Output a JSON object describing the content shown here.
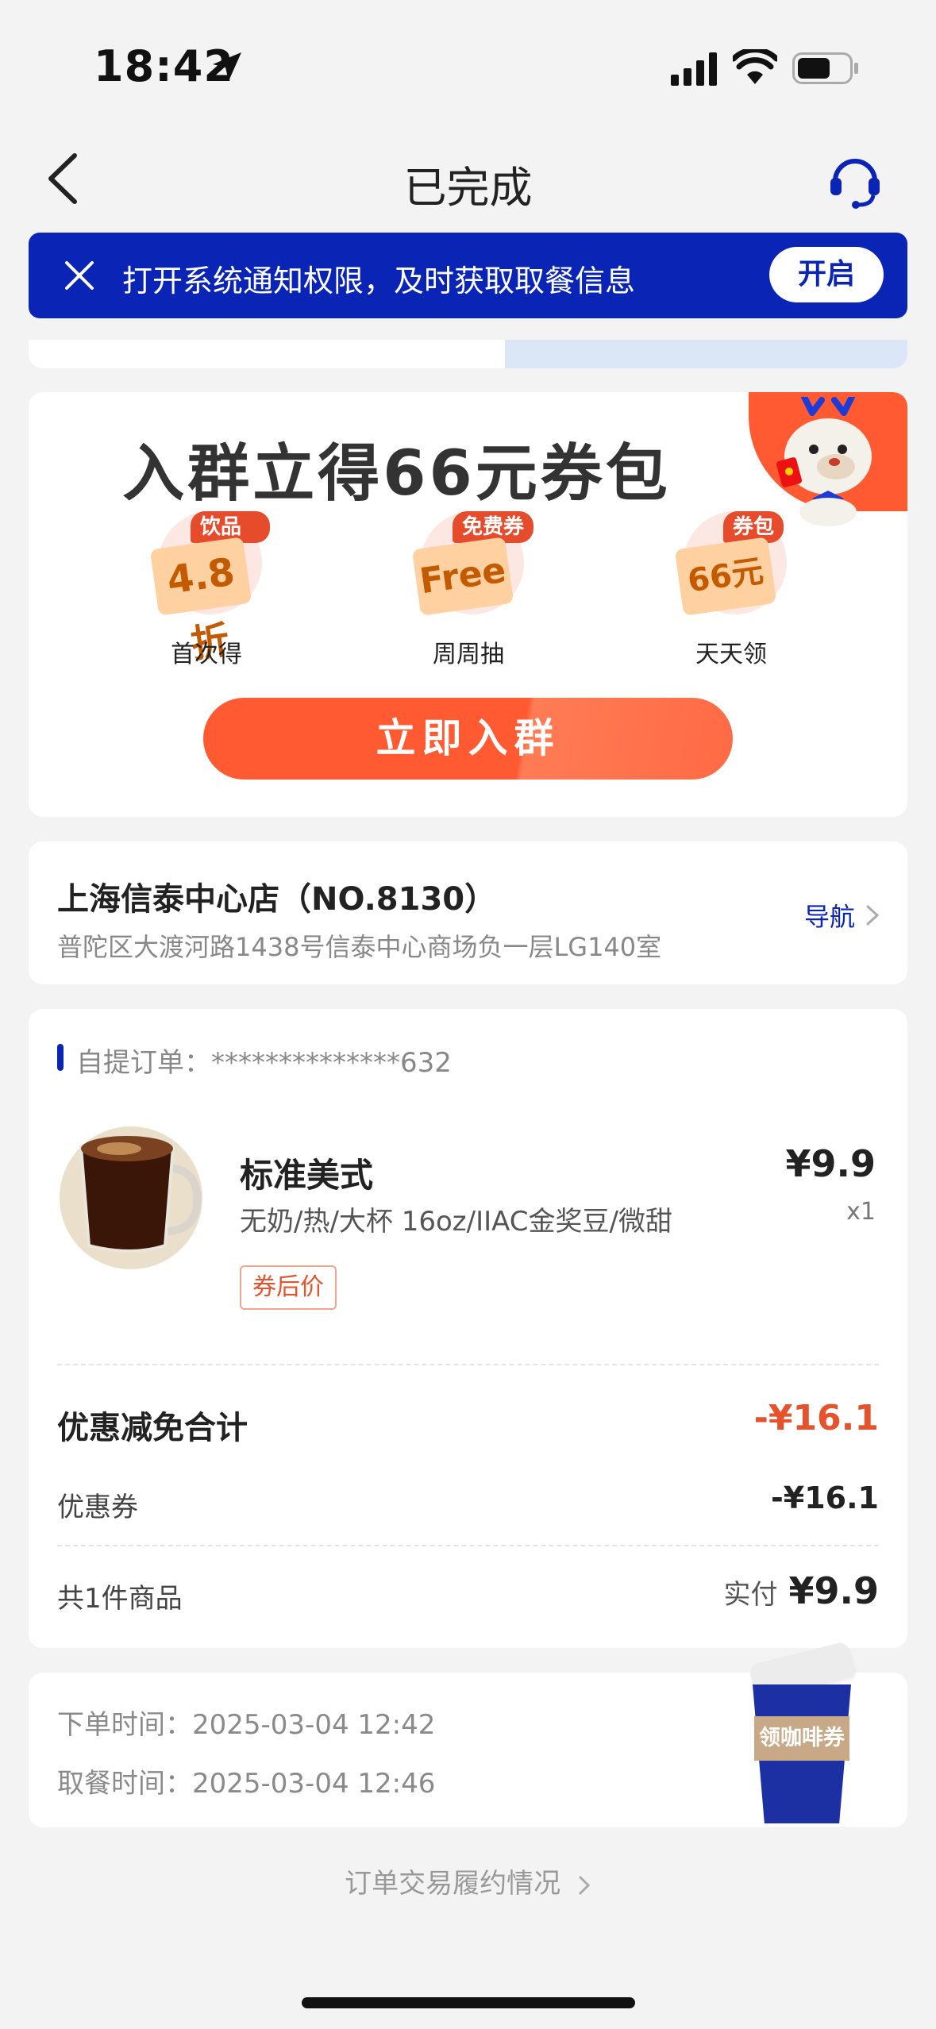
{
  "status_bar": {
    "time": "18:42"
  },
  "nav": {
    "title": "已完成"
  },
  "banner": {
    "text": "打开系统通知权限，及时获取取餐信息",
    "button": "开启"
  },
  "group_card": {
    "title": "入群立得66元券包",
    "benefits": [
      {
        "tag": "饮品券",
        "value": "4.8折",
        "label": "首次得"
      },
      {
        "tag": "免费券",
        "value": "Free",
        "label": "周周抽"
      },
      {
        "tag": "券包",
        "value": "66元",
        "label": "天天领"
      }
    ],
    "button": "立即入群"
  },
  "store": {
    "name": "上海信泰中心店（NO.8130）",
    "address": "普陀区大渡河路1438号信泰中心商场负一层LG140室",
    "nav_label": "导航"
  },
  "order": {
    "label": "自提订单：",
    "number": "**************632",
    "item": {
      "name": "标准美式",
      "spec": "无奶/热/大杯 16oz/IIAC金奖豆/微甜",
      "price": "¥9.9",
      "qty": "x1",
      "tag": "券后价"
    },
    "discount_total_label": "优惠减免合计",
    "discount_total_value": "-¥16.1",
    "coupon_label": "优惠券",
    "coupon_value": "-¥16.1",
    "count_label": "共1件商品",
    "paid_label": "实付",
    "paid_value": "¥9.9"
  },
  "times": {
    "order_time_label": "下单时间：",
    "order_time": "2025-03-04 12:42",
    "pickup_time_label": "取餐时间：",
    "pickup_time": "2025-03-04 12:46",
    "float_label": "领咖啡券"
  },
  "footer": {
    "link": "订单交易履约情况"
  },
  "colors": {
    "brand": "#0a24b5",
    "accent": "#ff5a32",
    "discount": "#e5522b"
  }
}
